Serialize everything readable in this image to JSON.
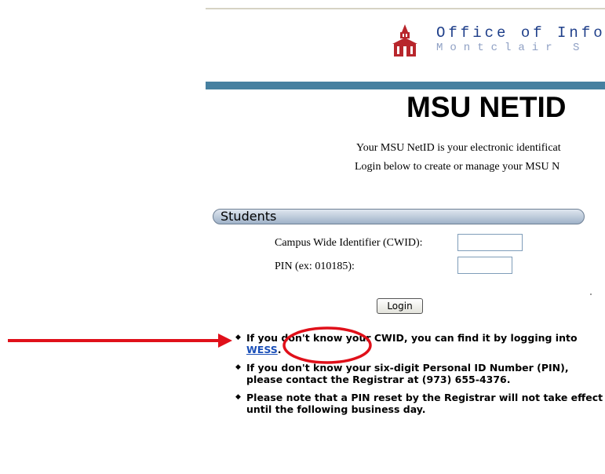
{
  "header": {
    "office_title": "Office of Infor",
    "office_subtitle": "Montclair S"
  },
  "main": {
    "title": "MSU NETID",
    "intro_line1": "Your MSU NetID is your electronic identificat",
    "intro_line2": "Login below to create or manage your MSU N"
  },
  "students": {
    "section_label": "Students",
    "cwid_label": "Campus Wide Identifier (CWID):",
    "cwid_value": "",
    "pin_label": "PIN (ex: 010185):",
    "pin_value": "",
    "login_label": "Login"
  },
  "notes": {
    "note1_prefix": "If you don't know your CWID, you can find it by logging into ",
    "note1_link": "WESS",
    "note1_suffix": ".",
    "note2": "If you don't know your six-digit Personal ID Number (PIN), please contact the Registrar at (973) 655-4376.",
    "note3": "Please note that a PIN reset by the Registrar will not take effect until the following business day."
  },
  "colors": {
    "accent": "#4680a0",
    "link": "#1a4fb8",
    "annotation": "#e0101a",
    "logo": "#b8262c"
  },
  "icons": {
    "logo": "building-logo-icon",
    "annotation_arrow": "arrow-right-icon",
    "annotation_circle": "circle-highlight-icon"
  }
}
